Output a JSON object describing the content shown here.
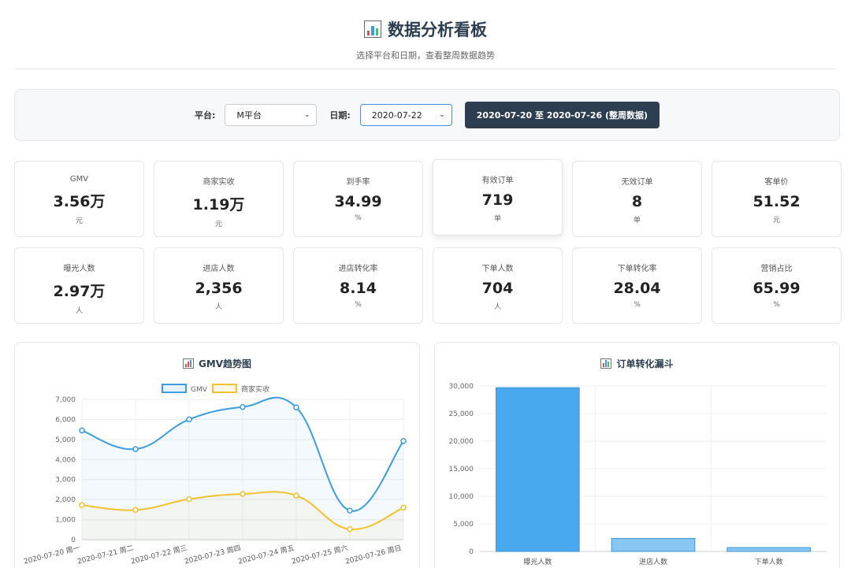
{
  "header": {
    "title": "数据分析看板",
    "subtitle": "选择平台和日期，查看整周数据趋势",
    "icon": "bar-chart-icon"
  },
  "controls": {
    "platform_label": "平台:",
    "platform_value": "M平台",
    "date_label": "日期:",
    "date_value": "2020-07-22",
    "range_button": "2020-07-20 至 2020-07-26 (整周数据)"
  },
  "metrics": [
    {
      "label": "GMV",
      "value": "3.56万",
      "unit": "元"
    },
    {
      "label": "商家实收",
      "value": "1.19万",
      "unit": "元"
    },
    {
      "label": "到手率",
      "value": "34.99",
      "unit": "%"
    },
    {
      "label": "有效订单",
      "value": "719",
      "unit": "单"
    },
    {
      "label": "无效订单",
      "value": "8",
      "unit": "单"
    },
    {
      "label": "客单价",
      "value": "51.52",
      "unit": "元"
    },
    {
      "label": "曝光人数",
      "value": "2.97万",
      "unit": "人"
    },
    {
      "label": "进店人数",
      "value": "2,356",
      "unit": "人"
    },
    {
      "label": "进店转化率",
      "value": "8.14",
      "unit": "%"
    },
    {
      "label": "下单人数",
      "value": "704",
      "unit": "人"
    },
    {
      "label": "下单转化率",
      "value": "28.04",
      "unit": "%"
    },
    {
      "label": "营销占比",
      "value": "65.99",
      "unit": "%"
    }
  ],
  "panels": {
    "left_title": "GMV趋势图",
    "right_title": "订单转化漏斗"
  },
  "colors": {
    "gmv": "#3b9de0",
    "merchant": "#f2c12e",
    "funnel_main": "#4aa8ee",
    "funnel_light": "#88c6f3",
    "dark_button": "#2d3e50"
  },
  "chart_data": [
    {
      "type": "line",
      "title": "GMV趋势图",
      "categories": [
        "2020-07-20 周一",
        "2020-07-21 周二",
        "2020-07-22 周三",
        "2020-07-23 周四",
        "2020-07-24 周五",
        "2020-07-25 周六",
        "2020-07-26 周日"
      ],
      "series": [
        {
          "name": "GMV",
          "values": [
            5450,
            4520,
            6000,
            6620,
            6600,
            1450,
            4920
          ]
        },
        {
          "name": "商家实收",
          "values": [
            1720,
            1480,
            2020,
            2280,
            2200,
            520,
            1600
          ]
        }
      ],
      "ylim": [
        0,
        7000
      ],
      "yticks": [
        "0",
        "1,000",
        "2,000",
        "3,000",
        "4,000",
        "5,000",
        "6,000",
        "7,000"
      ],
      "legend": "top",
      "grid": true
    },
    {
      "type": "bar",
      "title": "订单转化漏斗",
      "categories": [
        "曝光人数",
        "进店人数",
        "下单人数"
      ],
      "values": [
        29700,
        2356,
        704
      ],
      "ylim": [
        0,
        30000
      ],
      "yticks": [
        "0",
        "5,000",
        "10,000",
        "15,000",
        "20,000",
        "25,000",
        "30,000"
      ],
      "grid": true
    }
  ]
}
